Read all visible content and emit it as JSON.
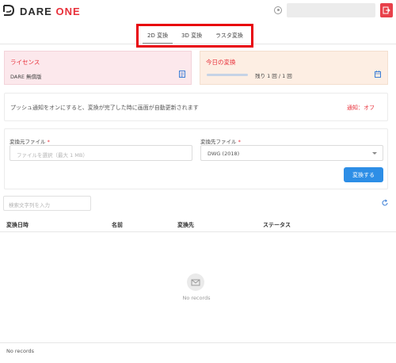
{
  "app": {
    "logo_word": "DARE",
    "logo_suffix": "ONE",
    "brand_color": "#e8303a"
  },
  "tabs": [
    {
      "label": "2D 変換",
      "active": true
    },
    {
      "label": "3D 変換",
      "active": false
    },
    {
      "label": "ラスタ変換",
      "active": false
    }
  ],
  "license_card": {
    "title": "ライセンス",
    "value": "DARE 無償版",
    "icon": "document-icon"
  },
  "today_card": {
    "title": "今日の変換",
    "remaining": "残り 1 回 / 1 回",
    "progress": 1.0,
    "icon": "calendar-icon"
  },
  "push": {
    "description": "プッシュ通知をオンにすると、変換が完了した時に画面が自動更新されます",
    "status": "通知：オフ"
  },
  "form": {
    "source_label": "変換元ファイル",
    "source_placeholder": "ファイルを選択（最大 1 MB）",
    "target_label": "変換先ファイル",
    "required_mark": "*",
    "target_value": "DWG (2018)",
    "convert_button": "変換する"
  },
  "search": {
    "placeholder": "検索文字列を入力"
  },
  "table": {
    "columns": [
      "変換日時",
      "名前",
      "変換先",
      "ステータス"
    ],
    "empty_text": "No records"
  },
  "footer": {
    "text": "No records"
  }
}
